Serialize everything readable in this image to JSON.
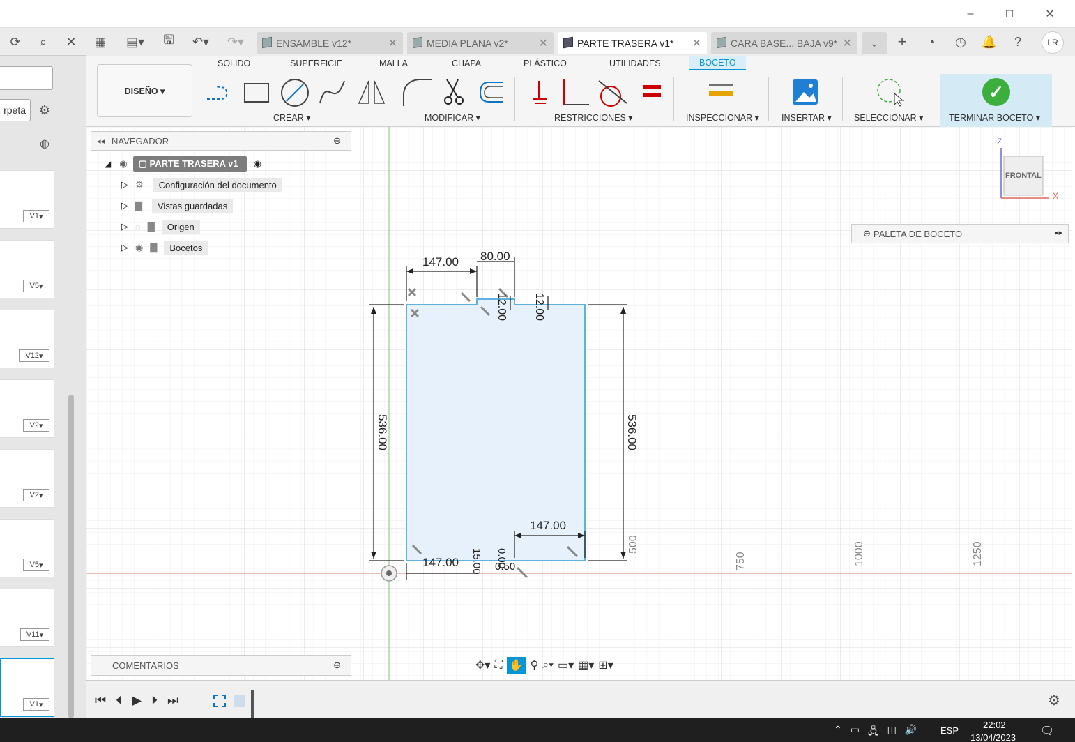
{
  "window": {
    "minimize": "–",
    "maximize": "☐",
    "close": "✕"
  },
  "left": {
    "folder_btn": "rpeta",
    "versions": [
      "V1",
      "V5",
      "V12",
      "V2",
      "V2",
      "V5",
      "V11",
      "V1"
    ]
  },
  "tabs": [
    {
      "label": "ENSAMBLE v12*"
    },
    {
      "label": "MEDIA PLANA v2*"
    },
    {
      "label": "PARTE TRASERA v1*"
    },
    {
      "label": "CARA BASE... BAJA v9*"
    }
  ],
  "user_initials": "LR",
  "ribbon": {
    "workspace": "DISEÑO ▾",
    "tabs": [
      "SOLIDO",
      "SUPERFICIE",
      "MALLA",
      "CHAPA",
      "PLÁSTICO",
      "UTILIDADES",
      "BOCETO"
    ],
    "groups": [
      "CREAR ▾",
      "MODIFICAR ▾",
      "RESTRICCIONES ▾",
      "INSPECCIONAR ▾",
      "INSERTAR ▾",
      "SELECCIONAR ▾",
      "TERMINAR BOCETO ▾"
    ]
  },
  "browser": {
    "title": "NAVEGADOR",
    "root": "PARTE TRASERA v1",
    "items": [
      "Configuración del documento",
      "Vistas guardadas",
      "Origen",
      "Bocetos"
    ]
  },
  "palette": "PALETA DE BOCETO",
  "comments": "COMENTARIOS",
  "viewcube": {
    "face": "FRONTAL",
    "z": "Z",
    "x": "X"
  },
  "dimensions": {
    "top_left": "147.00",
    "top_mid": "80.00",
    "notch1": "12.00",
    "notch2": "12.00",
    "left_h": "536.00",
    "right_h": "536.00",
    "bottom_right": "147.00",
    "bottom_left": "147.00",
    "bottom_a": "15.00",
    "bottom_b": "0.00",
    "bottom_c": "0.50"
  },
  "axis_ticks": [
    "500",
    "750",
    "1000",
    "1250"
  ],
  "taskbar": {
    "lang": "ESP",
    "time": "22:02",
    "date": "13/04/2023"
  }
}
